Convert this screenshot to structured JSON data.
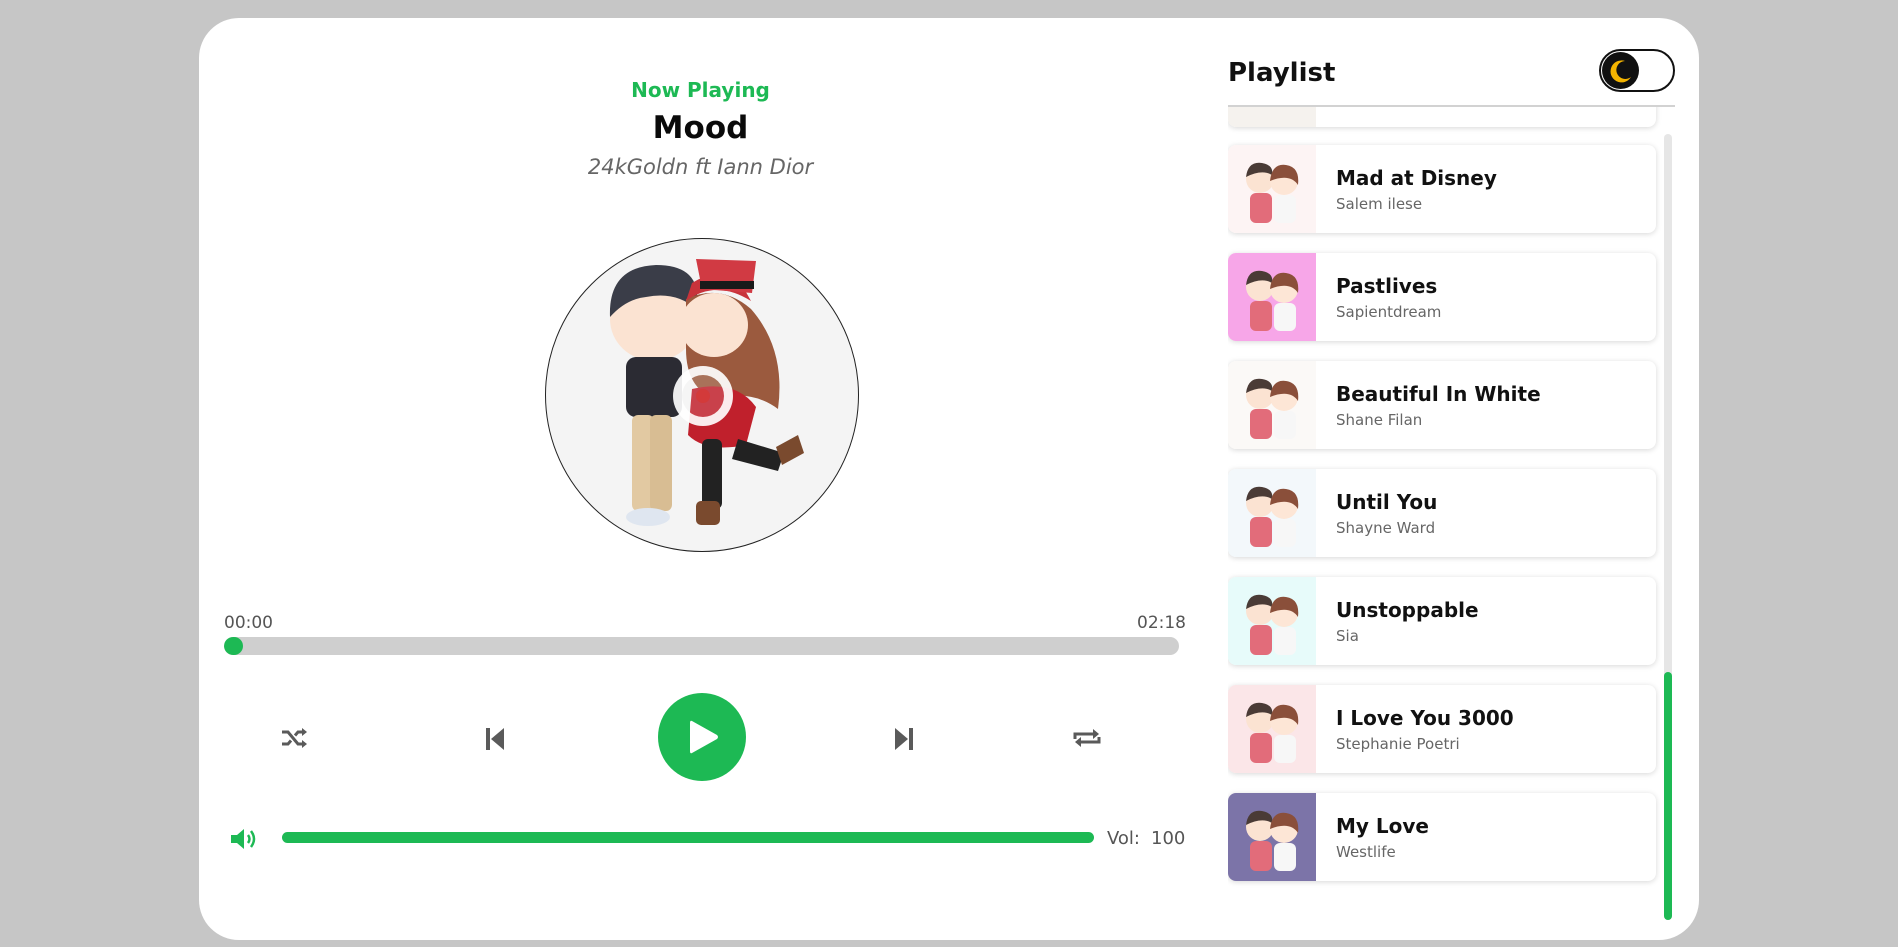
{
  "colors": {
    "accent": "#1db954",
    "background": "#c6c6c6",
    "card": "#ffffff"
  },
  "player": {
    "now_playing_label": "Now Playing",
    "title": "Mood",
    "artist": "24kGoldn ft Iann Dior",
    "current_time": "00:00",
    "duration": "02:18",
    "progress_fraction": 0.02,
    "volume_label": "Vol:",
    "volume_value": "100",
    "volume_fraction": 1.0,
    "controls": [
      "shuffle-icon",
      "previous-icon",
      "play-icon",
      "next-icon",
      "repeat-icon"
    ]
  },
  "playlist": {
    "title": "Playlist",
    "theme_toggle_icon": "moon-icon",
    "scroll_position_fraction": 0.68,
    "items": [
      {
        "name": "Mad at Disney",
        "artist": "Salem ilese",
        "thumb_bg": "#fdf4f4"
      },
      {
        "name": "Pastlives",
        "artist": "Sapientdream",
        "thumb_bg": "#f7a6e8"
      },
      {
        "name": "Beautiful In White",
        "artist": "Shane Filan",
        "thumb_bg": "#fbf9f7"
      },
      {
        "name": "Until You",
        "artist": "Shayne Ward",
        "thumb_bg": "#f3f8fb"
      },
      {
        "name": "Unstoppable",
        "artist": "Sia",
        "thumb_bg": "#e7fbfa"
      },
      {
        "name": "I Love You 3000",
        "artist": "Stephanie Poetri",
        "thumb_bg": "#fbe6e8"
      },
      {
        "name": "My Love",
        "artist": "Westlife",
        "thumb_bg": "#7c74a8"
      }
    ]
  }
}
